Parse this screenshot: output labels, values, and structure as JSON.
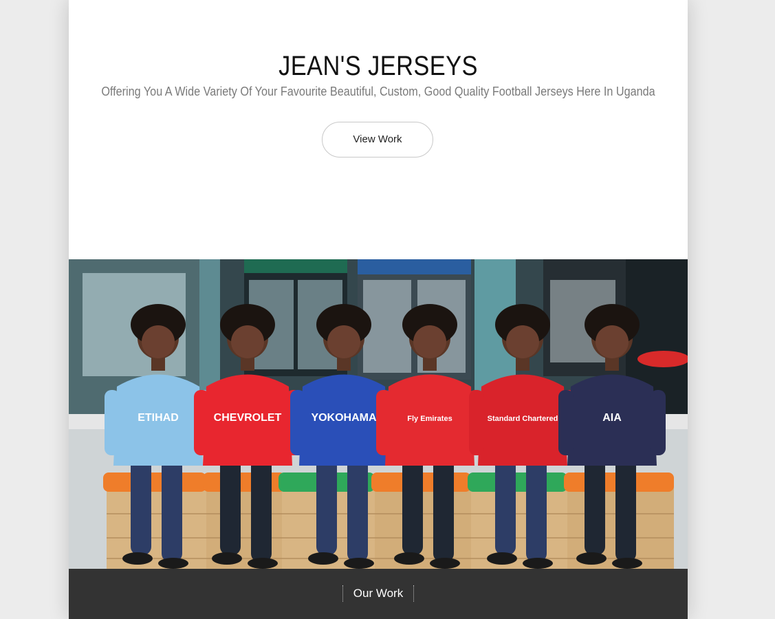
{
  "hero": {
    "title": "JEAN'S JERSEYS",
    "subtitle": "Offering You A Wide Variety Of Your Favourite Beautiful, Custom, Good Quality Football Jerseys Here In Uganda",
    "button_label": "View Work"
  },
  "photo": {
    "jerseys": [
      {
        "color": "#8cc3e8",
        "text": "ETIHAD"
      },
      {
        "color": "#e8262f",
        "text": "CHEVROLET"
      },
      {
        "color": "#2a4fb8",
        "text": "YOKOHAMA"
      },
      {
        "color": "#e42a30",
        "text": "Fly Emirates"
      },
      {
        "color": "#d9232b",
        "text": "Standard Chartered"
      },
      {
        "color": "#2b2f55",
        "text": "AIA"
      }
    ]
  },
  "section": {
    "label": "Our Work"
  },
  "colors": {
    "page_background": "#ececec",
    "bar_background": "#333333",
    "subtitle_text": "#7a7a7a"
  }
}
